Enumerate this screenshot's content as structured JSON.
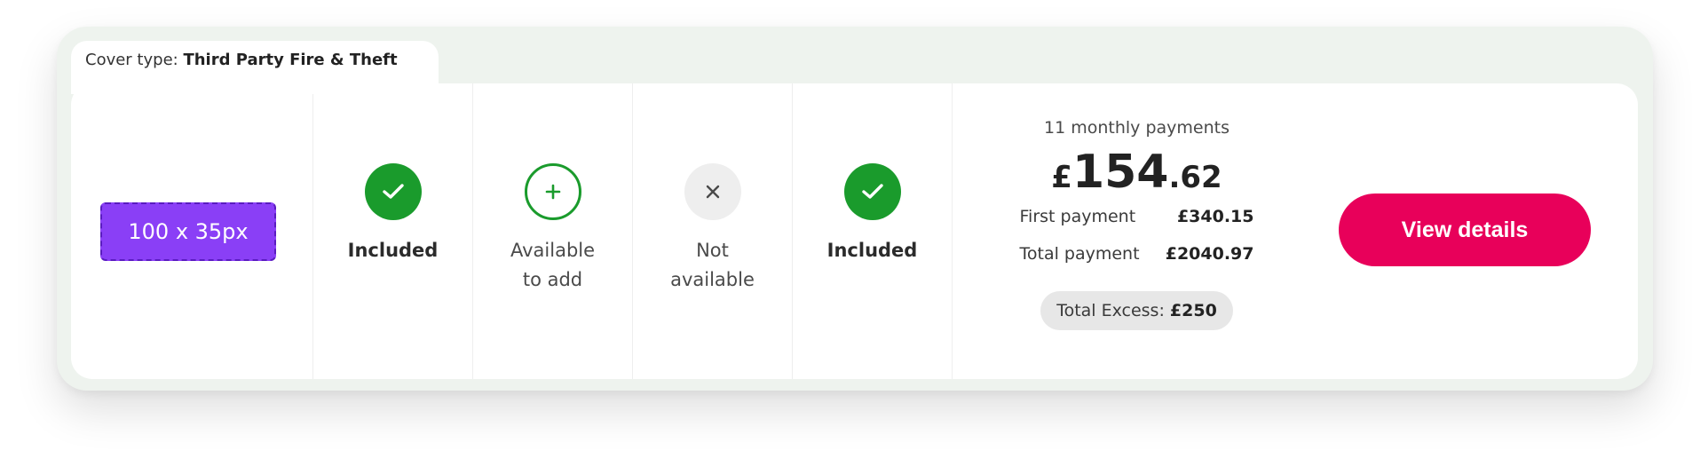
{
  "cover": {
    "label": "Cover type:",
    "value": "Third Party Fire & Theft"
  },
  "logo_placeholder": {
    "text": "100 x 35px"
  },
  "features": [
    {
      "status": "included",
      "icon": "check-icon",
      "label": "Included"
    },
    {
      "status": "available",
      "icon": "plus-icon",
      "label": "Available\nto add"
    },
    {
      "status": "not_available",
      "icon": "cross-icon",
      "label": "Not\navailable"
    },
    {
      "status": "included",
      "icon": "check-icon",
      "label": "Included"
    }
  ],
  "pricing": {
    "caption": "11 monthly payments",
    "currency": "£",
    "main": "154",
    "pence": ".62",
    "first_payment_label": "First payment",
    "first_payment_value": "£340.15",
    "total_payment_label": "Total payment",
    "total_payment_value": "£2040.97",
    "excess_label": "Total Excess:",
    "excess_value": "£250"
  },
  "cta": {
    "label": "View details"
  },
  "colors": {
    "included_green": "#1a9b2c",
    "cta_pink": "#e8005a",
    "placeholder_purple": "#8a3ff6"
  }
}
